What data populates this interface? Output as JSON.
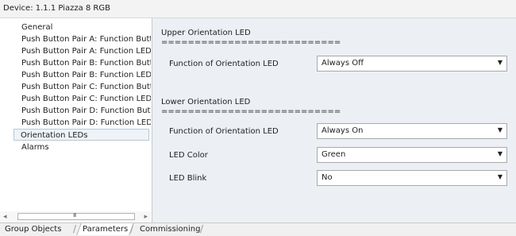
{
  "device": {
    "label": "Device: 1.1.1  Piazza 8 RGB"
  },
  "sidebar": {
    "items": [
      {
        "label": "General"
      },
      {
        "label": "Push Button Pair A: Function Buttons"
      },
      {
        "label": "Push Button Pair A: Function LEDs"
      },
      {
        "label": "Push Button Pair B: Function Buttons"
      },
      {
        "label": "Push Button Pair B: Function LEDs"
      },
      {
        "label": "Push Button Pair C: Function Buttons"
      },
      {
        "label": "Push Button Pair C: Function LEDs"
      },
      {
        "label": "Push Button Pair D: Function Buttons"
      },
      {
        "label": "Push Button Pair D: Function LEDs"
      },
      {
        "label": "Orientation LEDs"
      },
      {
        "label": "Alarms"
      }
    ],
    "selected_index": 9,
    "scrollbar_grip": "III"
  },
  "sections": {
    "upper": {
      "title": "Upper Orientation LED",
      "separator": "===========================",
      "function_label": "Function of Orientation LED",
      "function_value": "Always Off"
    },
    "lower": {
      "title": "Lower Orientation LED",
      "separator": "===========================",
      "function_label": "Function of Orientation LED",
      "function_value": "Always On",
      "color_label": "LED Color",
      "color_value": "Green",
      "blink_label": "LED Blink",
      "blink_value": "No"
    }
  },
  "tabs": [
    {
      "label": "Group Objects"
    },
    {
      "label": "Parameters"
    },
    {
      "label": "Commissioning"
    }
  ],
  "icons": {
    "dropdown_caret": "caret-down-icon",
    "scroll_left": "arrow-left-icon",
    "scroll_right": "arrow-right-icon"
  }
}
